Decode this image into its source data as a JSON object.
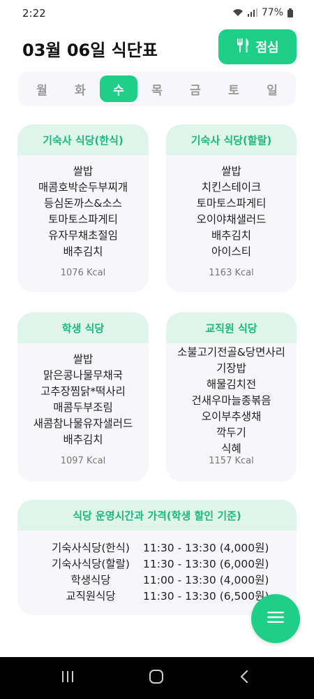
{
  "status_bar": {
    "time": "2:22",
    "battery": "77%"
  },
  "header": {
    "title": "03월 06일 식단표",
    "meal_button_label": "점심",
    "meal_icon": "fork-knife-icon"
  },
  "days": {
    "items": [
      {
        "label": "월"
      },
      {
        "label": "화"
      },
      {
        "label": "수"
      },
      {
        "label": "목"
      },
      {
        "label": "금"
      },
      {
        "label": "토"
      },
      {
        "label": "일"
      }
    ],
    "selected": "수"
  },
  "cafeterias": [
    {
      "name": "기숙사 식당(한식)",
      "menu": [
        "쌀밥",
        "매콤호박순두부찌개",
        "등심돈까스&소스",
        "토마토스파게티",
        "유자무채초절임",
        "배추김치"
      ],
      "kcal": "1076 Kcal"
    },
    {
      "name": "기숙사 식당(할랄)",
      "menu": [
        "쌀밥",
        "치킨스테이크",
        "토마토스파게티",
        "오이야채샐러드",
        "배추김치",
        "아이스티"
      ],
      "kcal": "1163 Kcal"
    },
    {
      "name": "학생 식당",
      "menu": [
        "쌀밥",
        "맑은콩나물무채국",
        "고추장찜닭*떡사리",
        "매콤두부조림",
        "새콤참나물유자샐러드",
        "배추김치"
      ],
      "kcal": "1097 Kcal"
    },
    {
      "name": "교직원 식당",
      "menu": [
        "소불고기전골&당면사리",
        "기장밥",
        "해물김치전",
        "건새우마늘종볶음",
        "오이부추생채",
        "깍두기",
        "식혜"
      ],
      "kcal": "1157 Kcal"
    }
  ],
  "hours": {
    "title": "식당 운영시간과 가격(학생 할인 기준)",
    "rows": [
      {
        "name": "기숙사식당(한식)",
        "time": "11:30 - 13:30 (4,000원)"
      },
      {
        "name": "기숙사식당(할랄)",
        "time": "11:30 - 13:30 (6,000원)"
      },
      {
        "name": "학생식당",
        "time": "11:00 - 13:30 (4,000원)"
      },
      {
        "name": "교직원식당",
        "time": "11:30 - 13:30 (6,500원)"
      }
    ]
  },
  "colors": {
    "accent": "#1ecf88",
    "accent_light": "#dff5ec",
    "card_bg": "#f7f7fa"
  }
}
